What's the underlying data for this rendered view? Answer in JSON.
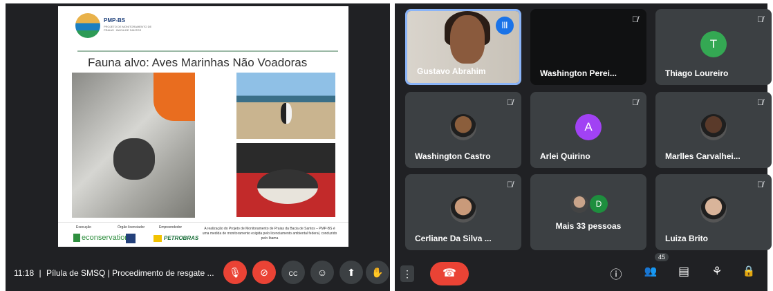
{
  "presentation": {
    "logo_title": "PMP-BS",
    "logo_subtitle": "PROJETO DE MONITORAMENTO DE PRAIAS · BACIA DE SANTOS",
    "slide_title": "Fauna alvo: Aves Marinhas Não Voadoras",
    "footer": {
      "col1_label": "Execução",
      "col2_label": "Órgão licenciador",
      "col3_label": "Empreendedor",
      "econ_text": "econservation",
      "petro_text": "PETROBRAS",
      "note": "A realização do Projeto de Monitoramento de Praias da Bacia de Santos – PMP-BS é uma medida de monitoramento exigida pelo licenciamento ambiental federal, conduzido pelo Ibama"
    }
  },
  "meeting_bar": {
    "time": "11:18",
    "separator": "|",
    "meeting_title": "Pílula de SMSQ | Procedimento de resgate ...",
    "buttons": [
      {
        "icon": "mic-off-icon",
        "glyph": "🎙",
        "style": "red"
      },
      {
        "icon": "camera-off-icon",
        "glyph": "⊘",
        "style": "red"
      },
      {
        "icon": "captions-icon",
        "glyph": "CC",
        "style": "gray"
      },
      {
        "icon": "emoji-icon",
        "glyph": "☺",
        "style": "gray"
      },
      {
        "icon": "present-icon",
        "glyph": "⬆",
        "style": "gray"
      },
      {
        "icon": "raise-hand-icon",
        "glyph": "✋",
        "style": "gray"
      }
    ]
  },
  "participants": [
    {
      "name": "Gustavo Abrahim",
      "type": "video",
      "speaking": true
    },
    {
      "name": "Washington Perei...",
      "type": "dark",
      "muted": true
    },
    {
      "name": "Thiago Loureiro",
      "type": "initial",
      "initial": "T",
      "color": "#34a853",
      "muted": true
    },
    {
      "name": "Washington Castro",
      "type": "photo",
      "muted": true,
      "color": "#8b5e3c"
    },
    {
      "name": "Arlei Quirino",
      "type": "initial",
      "initial": "A",
      "color": "#a142f4",
      "muted": true
    },
    {
      "name": "Marlles Carvalhei...",
      "type": "photo",
      "muted": true,
      "color": "#5a3a2a"
    },
    {
      "name": "Cerliane Da Silva ...",
      "type": "photo",
      "muted": true,
      "color": "#c99a7a"
    },
    {
      "name": "Mais 33 pessoas",
      "type": "more",
      "initial": "D",
      "color": "#1e8e3e"
    },
    {
      "name": "Luiza Brito",
      "type": "photo",
      "muted": true,
      "color": "#d9b49a"
    }
  ],
  "controls_right": {
    "more_glyph": "⋮",
    "end_call_glyph": "☎",
    "info_glyph": "ⓘ",
    "people_glyph": "👥",
    "people_count": "45",
    "chat_glyph": "▤",
    "activities_glyph": "⚘",
    "lock_glyph": "🔒"
  },
  "colors": {
    "background": "#202124",
    "tile": "#3c4043",
    "danger": "#ea4335",
    "accent": "#8ab4f8"
  }
}
